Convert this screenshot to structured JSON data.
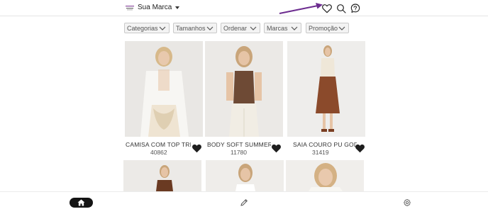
{
  "header": {
    "brand_name": "Sua Marca",
    "icons": [
      "brand-logo-icon",
      "heart-icon",
      "search-icon",
      "chat-icon"
    ],
    "accent_arrow_color": "#6c2c8f"
  },
  "filters": [
    {
      "label": "Categorias"
    },
    {
      "label": "Tamanhos"
    },
    {
      "label": "Ordenar"
    },
    {
      "label": "Marcas"
    },
    {
      "label": "Promoção"
    }
  ],
  "products": [
    {
      "name": "CAMISA COM TOP TRIC...",
      "code": "40862"
    },
    {
      "name": "BODY SOFT SUMMER PR...",
      "code": "11780"
    },
    {
      "name": "SAIA COURO PU GODE",
      "code": "31419"
    }
  ],
  "bottom_nav": {
    "icons": [
      "home-icon",
      "pencil-icon",
      "gear-icon"
    ],
    "active": "home-icon"
  }
}
